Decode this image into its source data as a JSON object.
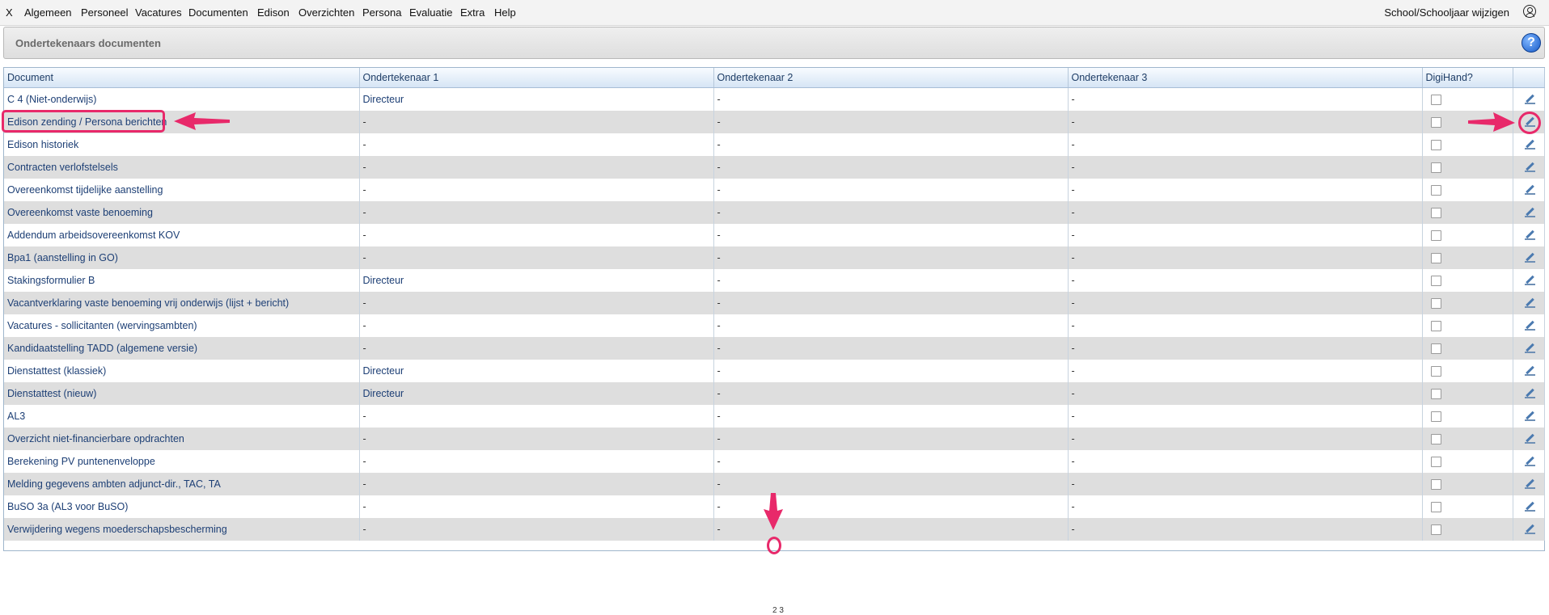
{
  "menu": {
    "close": "X",
    "items": [
      "Algemeen",
      "Personeel",
      "Vacatures",
      "Documenten",
      "Edison",
      "Overzichten",
      "Persona",
      "Evaluatie",
      "Extra",
      "Help"
    ],
    "right_link": "School/Schooljaar wijzigen"
  },
  "panel": {
    "title": "Ondertekenaars documenten",
    "help_symbol": "?"
  },
  "table": {
    "headers": [
      "Document",
      "Ondertekenaar 1",
      "Ondertekenaar 2",
      "Ondertekenaar 3",
      "DigiHand?",
      ""
    ],
    "rows": [
      {
        "document": "C 4 (Niet-onderwijs)",
        "o1": "Directeur",
        "o2": "-",
        "o3": "-"
      },
      {
        "document": "Edison zending / Persona berichten",
        "o1": "-",
        "o2": "-",
        "o3": "-"
      },
      {
        "document": "Edison historiek",
        "o1": "-",
        "o2": "-",
        "o3": "-"
      },
      {
        "document": "Contracten verlofstelsels",
        "o1": "-",
        "o2": "-",
        "o3": "-"
      },
      {
        "document": "Overeenkomst tijdelijke aanstelling",
        "o1": "-",
        "o2": "-",
        "o3": "-"
      },
      {
        "document": "Overeenkomst vaste benoeming",
        "o1": "-",
        "o2": "-",
        "o3": "-"
      },
      {
        "document": "Addendum arbeidsovereenkomst KOV",
        "o1": "-",
        "o2": "-",
        "o3": "-"
      },
      {
        "document": "Bpa1 (aanstelling in GO)",
        "o1": "-",
        "o2": "-",
        "o3": "-"
      },
      {
        "document": "Stakingsformulier B",
        "o1": "Directeur",
        "o2": "-",
        "o3": "-"
      },
      {
        "document": "Vacantverklaring vaste benoeming vrij onderwijs (lijst + bericht)",
        "o1": "-",
        "o2": "-",
        "o3": "-"
      },
      {
        "document": "Vacatures - sollicitanten (wervingsambten)",
        "o1": "-",
        "o2": "-",
        "o3": "-"
      },
      {
        "document": "Kandidaatstelling TADD (algemene versie)",
        "o1": "-",
        "o2": "-",
        "o3": "-"
      },
      {
        "document": "Dienstattest (klassiek)",
        "o1": "Directeur",
        "o2": "-",
        "o3": "-"
      },
      {
        "document": "Dienstattest (nieuw)",
        "o1": "Directeur",
        "o2": "-",
        "o3": "-"
      },
      {
        "document": "AL3",
        "o1": "-",
        "o2": "-",
        "o3": "-"
      },
      {
        "document": "Overzicht niet-financierbare opdrachten",
        "o1": "-",
        "o2": "-",
        "o3": "-"
      },
      {
        "document": "Berekening PV puntenenveloppe",
        "o1": "-",
        "o2": "-",
        "o3": "-"
      },
      {
        "document": "Melding gegevens ambten adjunct-dir., TAC, TA",
        "o1": "-",
        "o2": "-",
        "o3": "-"
      },
      {
        "document": "BuSO 3a (AL3 voor BuSO)",
        "o1": "-",
        "o2": "-",
        "o3": "-"
      },
      {
        "document": "Verwijdering wegens moederschapsbescherming",
        "o1": "-",
        "o2": "-",
        "o3": "-"
      }
    ]
  },
  "pager": {
    "pages": "2 3"
  },
  "colors": {
    "annotation": "#e8296a",
    "link": "#1d3f75",
    "row_alt": "#dedede"
  }
}
